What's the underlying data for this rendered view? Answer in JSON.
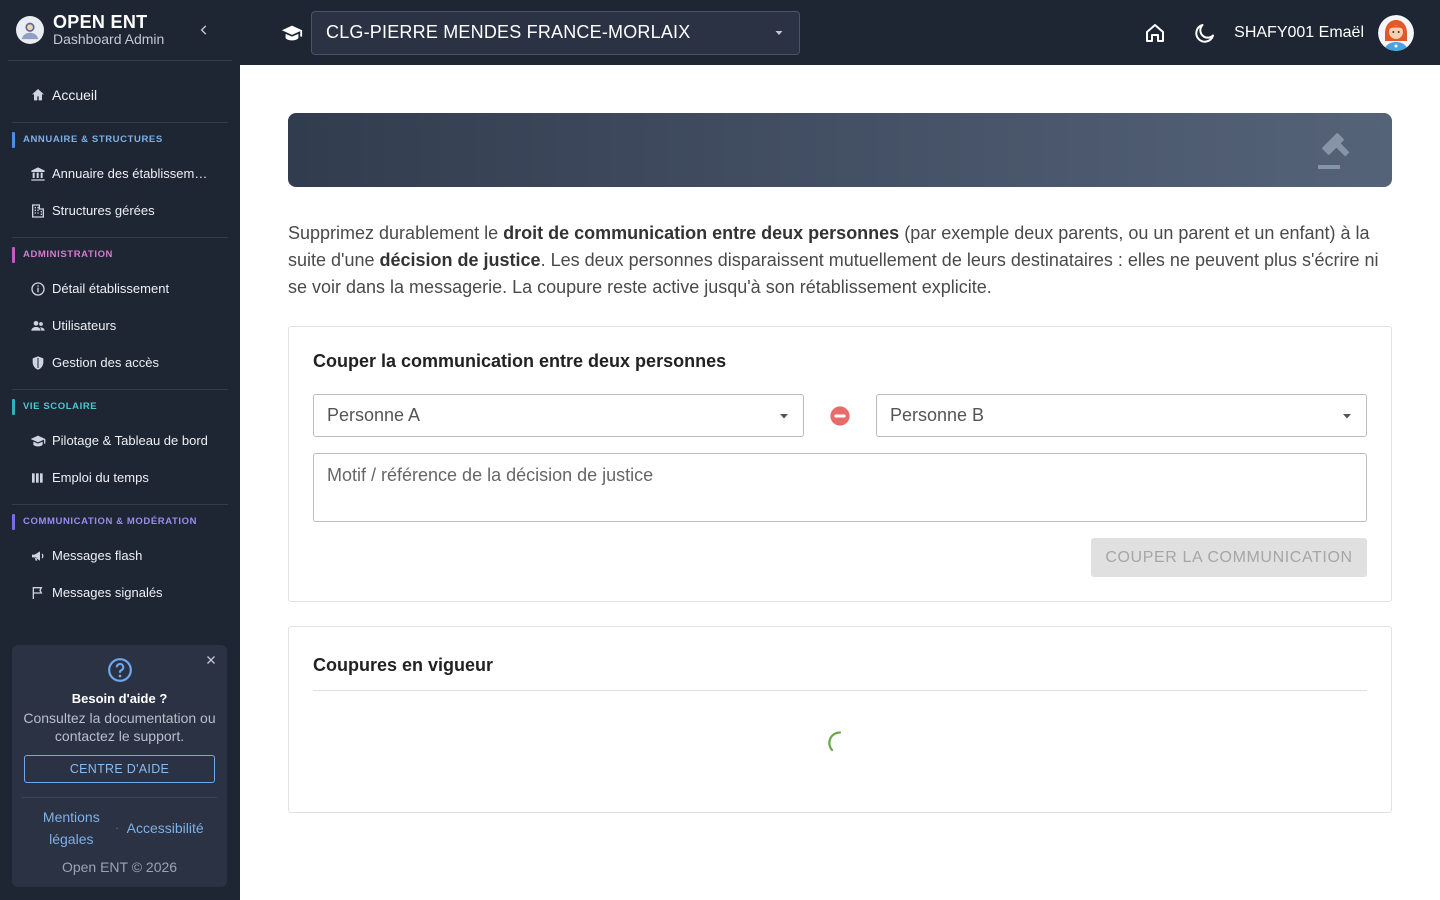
{
  "brand": {
    "title": "OPEN ENT",
    "subtitle": "Dashboard Admin"
  },
  "sidebar": {
    "home": "Accueil",
    "sections": [
      {
        "title": "Annuaire & structures",
        "items": [
          "Annuaire des établissements",
          "Structures gérées"
        ]
      },
      {
        "title": "Administration",
        "items": [
          "Détail établissement",
          "Utilisateurs",
          "Gestion des accès"
        ]
      },
      {
        "title": "Vie scolaire",
        "items": [
          "Pilotage & Tableau de bord",
          "Emploi du temps"
        ]
      },
      {
        "title": "Communication & modération",
        "items": [
          "Messages flash",
          "Messages signalés"
        ]
      }
    ]
  },
  "help": {
    "title": "Besoin d'aide ?",
    "text": "Consultez la documentation ou contactez le support.",
    "button": "CENTRE D'AIDE",
    "link_legal": "Mentions légales",
    "link_access": "Accessibilité",
    "copyright": "Open ENT © 2026"
  },
  "topbar": {
    "etablissement": "CLG-PIERRE MENDES FRANCE-MORLAIX",
    "username": "SHAFY001 Emaël"
  },
  "intro": {
    "p1": "Supprimez durablement le ",
    "b1": "droit de communication entre deux personnes",
    "p2": " (par exemple deux parents, ou un parent et un enfant) à la suite d'une ",
    "b2": "décision de justice",
    "p3": ". Les deux personnes disparaissent mutuellement de leurs destinataires : elles ne peuvent plus s'écrire ni se voir dans la messagerie. La coupure reste active jusqu'à son rétablissement explicite."
  },
  "form": {
    "title": "Couper la communication entre deux personnes",
    "person_a": "Personne A",
    "person_b": "Personne B",
    "motif_placeholder": "Motif / référence de la décision de justice",
    "submit": "COUPER LA COMMUNICATION"
  },
  "active": {
    "title": "Coupures en vigueur"
  },
  "colors": {
    "sidebar_bg": "#1e2533",
    "accent": "#4a90e2",
    "danger": "#e55353",
    "spinner": "#6aa84f"
  }
}
